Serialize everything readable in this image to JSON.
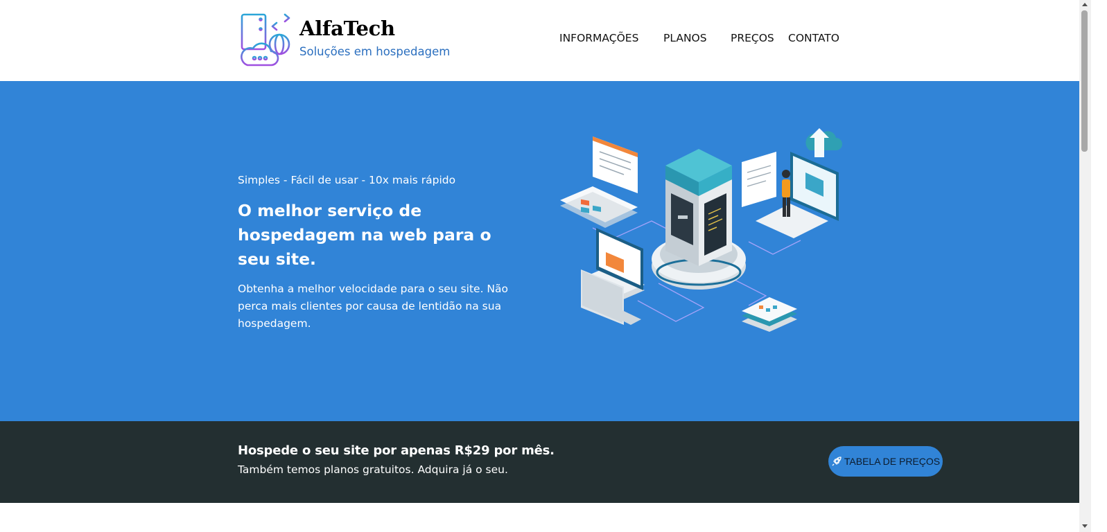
{
  "header": {
    "brand_name": "AlfaTech",
    "brand_tagline": "Soluções em hospedagem",
    "logo_icon": "server-cloud-globe-icon",
    "nav": [
      {
        "label": "INFORMAÇÕES"
      },
      {
        "label": "PLANOS"
      },
      {
        "label": "PREÇOS"
      },
      {
        "label": "CONTATO"
      }
    ]
  },
  "hero": {
    "kicker": "Simples - Fácil de usar - 10x mais rápido",
    "title": "O melhor serviço de hospedagem na web para o seu site.",
    "description": "Obtenha a melhor velocidade para o seu site. Não perca mais clientes por causa de lentidão na sua hospedagem.",
    "illustration": "isometric-server-illustration"
  },
  "cta": {
    "title": "Hospede o seu site por apenas R$29 por mês.",
    "subtitle": "Também temos planos gratuitos. Adquira já o seu.",
    "button_label": "TABELA DE PREÇOS",
    "button_icon": "rocket-icon"
  },
  "colors": {
    "hero_bg": "#3184d7",
    "cta_bg": "#232f31",
    "tagline": "#2b6fbf",
    "button_bg": "#3184d7"
  }
}
